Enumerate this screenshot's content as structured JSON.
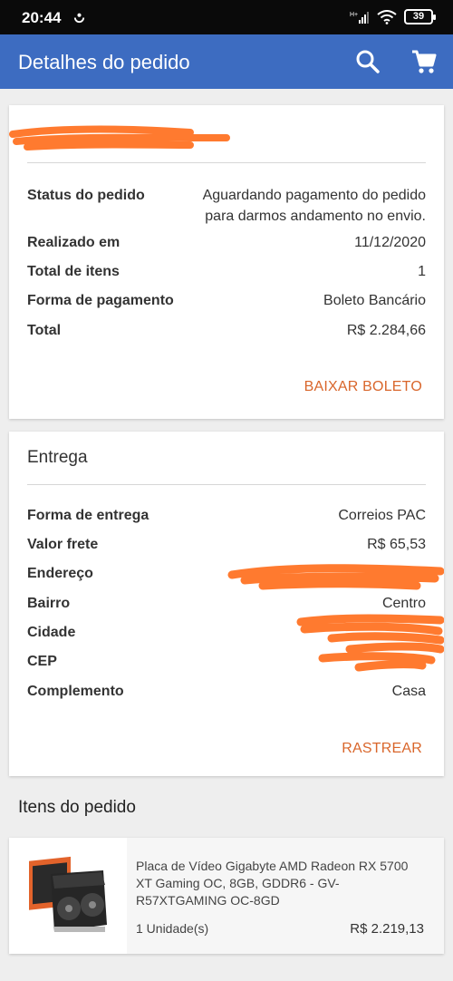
{
  "status_bar": {
    "time": "20:44",
    "battery": "39",
    "network_label": "H+"
  },
  "app_bar": {
    "title": "Detalhes do pedido",
    "search_icon": "search-icon",
    "cart_icon": "cart-icon"
  },
  "order": {
    "status_label": "Status do pedido",
    "status_value": "Aguardando pagamento do pedido para darmos andamento no envio.",
    "date_label": "Realizado em",
    "date_value": "11/12/2020",
    "items_label": "Total de itens",
    "items_value": "1",
    "payment_label": "Forma de pagamento",
    "payment_value": "Boleto Bancário",
    "total_label": "Total",
    "total_value": "R$ 2.284,66",
    "action_label": "BAIXAR BOLETO"
  },
  "delivery": {
    "title": "Entrega",
    "method_label": "Forma de entrega",
    "method_value": "Correios PAC",
    "freight_label": "Valor frete",
    "freight_value": "R$ 65,53",
    "address_label": "Endereço",
    "district_label": "Bairro",
    "district_value": "Centro",
    "city_label": "Cidade",
    "zip_label": "CEP",
    "complement_label": "Complemento",
    "complement_value": "Casa",
    "action_label": "RASTREAR"
  },
  "items_section": {
    "title": "Itens do pedido",
    "items": [
      {
        "name": "Placa de Vídeo Gigabyte AMD Radeon RX 5700 XT Gaming OC, 8GB, GDDR6 - GV-R57XTGAMING OC-8GD",
        "quantity": "1 Unidade(s)",
        "price": "R$ 2.219,13"
      }
    ]
  },
  "colors": {
    "app_bar": "#3d6cc1",
    "accent": "#d9662b",
    "redaction": "#ff7a2f",
    "background": "#eeeeee"
  }
}
